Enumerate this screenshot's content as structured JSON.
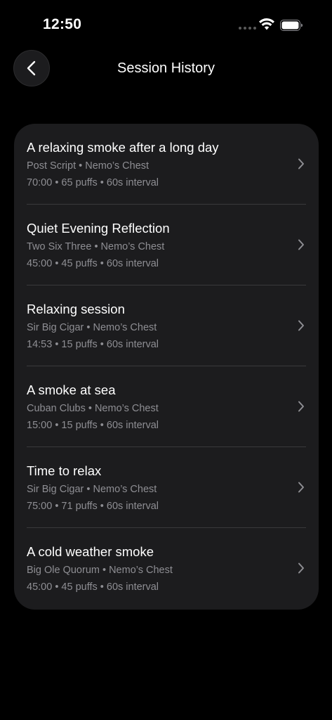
{
  "status_bar": {
    "time": "12:50",
    "icons": [
      "signal-dots-icon",
      "wifi-icon",
      "battery-icon"
    ]
  },
  "nav": {
    "title": "Session History",
    "back_icon": "chevron-left-icon"
  },
  "colors": {
    "background": "#000000",
    "card": "#1c1c1e",
    "secondary_text": "#8e8e93",
    "divider": "#3a3a3c"
  },
  "sessions": [
    {
      "title": "A relaxing smoke after a long day",
      "subtitle": "Post Script • Nemo’s Chest",
      "meta": "70:00 • 65 puffs • 60s interval"
    },
    {
      "title": "Quiet Evening Reflection",
      "subtitle": "Two Six Three • Nemo’s Chest",
      "meta": "45:00 • 45 puffs • 60s interval"
    },
    {
      "title": "Relaxing session",
      "subtitle": "Sir Big Cigar • Nemo’s Chest",
      "meta": "14:53 • 15 puffs • 60s interval"
    },
    {
      "title": "A smoke at sea",
      "subtitle": "Cuban Clubs • Nemo’s Chest",
      "meta": "15:00 • 15 puffs • 60s interval"
    },
    {
      "title": "Time to relax",
      "subtitle": "Sir Big Cigar • Nemo’s Chest",
      "meta": "75:00 • 71 puffs • 60s interval"
    },
    {
      "title": "A cold weather smoke",
      "subtitle": "Big Ole Quorum • Nemo’s Chest",
      "meta": "45:00 • 45 puffs • 60s interval"
    }
  ]
}
